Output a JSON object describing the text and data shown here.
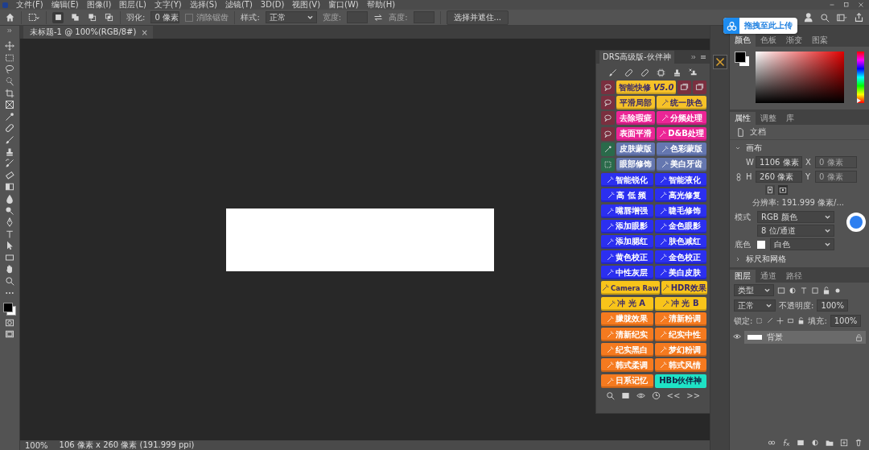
{
  "menu": [
    "文件(F)",
    "编辑(E)",
    "图像(I)",
    "图层(L)",
    "文字(Y)",
    "选择(S)",
    "滤镜(T)",
    "3D(D)",
    "视图(V)",
    "窗口(W)",
    "帮助(H)"
  ],
  "options": {
    "modes": [
      {
        "selected": true
      },
      {
        "selected": false
      },
      {
        "selected": false
      },
      {
        "selected": false
      }
    ],
    "feather_label": "羽化:",
    "feather_value": "0 像素",
    "antialias": {
      "label": "消除锯齿",
      "checked": false,
      "disabled": true
    },
    "style_label": "样式:",
    "style_value": "正常",
    "width_label": "宽度:",
    "height_label": "高度:",
    "mask_button": "选择并遮住..."
  },
  "document_tab": {
    "title": "未标题-1 @ 100%(RGB/8#)",
    "close": "×"
  },
  "upload_badge": "拖拽至此上传",
  "plugin": {
    "title": "DRS高级版-伙伴神",
    "prev": "<<",
    "next": ">>",
    "rows": [
      {
        "kind": "title",
        "cells": [
          {
            "kind": "tool",
            "color": "#7a2f3f"
          },
          {
            "kind": "button",
            "label": "智能快修 *V5.0*",
            "color": "#f6c228"
          },
          {
            "kind": "tool",
            "color": "#7a2f3f"
          },
          {
            "kind": "tool",
            "color": "#7a2f3f"
          }
        ]
      },
      {
        "kind": "lead",
        "cells": [
          {
            "kind": "tool",
            "color": "#7a2f3f"
          },
          {
            "kind": "button",
            "label": "平滑局部",
            "color": "#f6c228"
          },
          {
            "kind": "button",
            "label": "统一肤色",
            "color": "#f6c228"
          }
        ]
      },
      {
        "kind": "lead",
        "cells": [
          {
            "kind": "tool",
            "color": "#7a2f3f"
          },
          {
            "kind": "button",
            "label": "去除瑕疵",
            "color": "#ec2596"
          },
          {
            "kind": "button",
            "label": "分频处理",
            "color": "#ec2596"
          }
        ]
      },
      {
        "kind": "lead",
        "cells": [
          {
            "kind": "tool",
            "color": "#7a2f3f"
          },
          {
            "kind": "button",
            "label": "表面平滑",
            "color": "#ec2596"
          },
          {
            "kind": "button",
            "label": "D&B处理",
            "color": "#ec2596"
          }
        ]
      },
      {
        "kind": "lead",
        "cells": [
          {
            "kind": "tool",
            "color": "#2a6a4a"
          },
          {
            "kind": "button",
            "label": "皮肤蒙版",
            "color": "#6577b0"
          },
          {
            "kind": "button",
            "label": "色彩蒙版",
            "color": "#6577b0"
          }
        ]
      },
      {
        "kind": "lead",
        "cells": [
          {
            "kind": "tool",
            "color": "#2a6a4a"
          },
          {
            "kind": "button",
            "label": "眼部修饰",
            "color": "#6577b0"
          },
          {
            "kind": "button",
            "label": "美白牙齿",
            "color": "#6577b0"
          }
        ]
      },
      {
        "kind": "pair",
        "cells": [
          {
            "kind": "button",
            "label": "智能锐化",
            "color": "#2b2ff0"
          },
          {
            "kind": "button",
            "label": "智能液化",
            "color": "#2b2ff0"
          }
        ]
      },
      {
        "kind": "pair",
        "cells": [
          {
            "kind": "button",
            "label": "高 低 频",
            "color": "#2b2ff0"
          },
          {
            "kind": "button",
            "label": "高光修复",
            "color": "#2b2ff0"
          }
        ]
      },
      {
        "kind": "pair",
        "cells": [
          {
            "kind": "button",
            "label": "嘴唇增强",
            "color": "#2b2ff0"
          },
          {
            "kind": "button",
            "label": "睫毛修饰",
            "color": "#2b2ff0"
          }
        ]
      },
      {
        "kind": "pair",
        "cells": [
          {
            "kind": "button",
            "label": "添加眼影",
            "color": "#2b2ff0"
          },
          {
            "kind": "button",
            "label": "金色眼影",
            "color": "#2b2ff0"
          }
        ]
      },
      {
        "kind": "pair",
        "cells": [
          {
            "kind": "button",
            "label": "添加腮红",
            "color": "#2b2ff0"
          },
          {
            "kind": "button",
            "label": "肤色减红",
            "color": "#2b2ff0"
          }
        ]
      },
      {
        "kind": "pair",
        "cells": [
          {
            "kind": "button",
            "label": "黄色校正",
            "color": "#2b2ff0"
          },
          {
            "kind": "button",
            "label": "金色校正",
            "color": "#2b2ff0"
          }
        ]
      },
      {
        "kind": "pair",
        "cells": [
          {
            "kind": "button",
            "label": "中性灰层",
            "color": "#2b2ff0"
          },
          {
            "kind": "button",
            "label": "美白皮肤",
            "color": "#2b2ff0"
          }
        ]
      },
      {
        "kind": "pair",
        "cells": [
          {
            "kind": "button",
            "label": "Camera Raw",
            "color": "#f8c41a"
          },
          {
            "kind": "button",
            "label": "HDR效果",
            "color": "#f8c41a"
          }
        ]
      },
      {
        "kind": "pair",
        "cells": [
          {
            "kind": "button",
            "label": "冲 光 A",
            "color": "#f8c41a"
          },
          {
            "kind": "button",
            "label": "冲 光 B",
            "color": "#f8c41a"
          }
        ]
      },
      {
        "kind": "pair",
        "cells": [
          {
            "kind": "button",
            "label": "朦胧效果",
            "color": "#f57a1f"
          },
          {
            "kind": "button",
            "label": "清新粉调",
            "color": "#f57a1f"
          }
        ]
      },
      {
        "kind": "pair",
        "cells": [
          {
            "kind": "button",
            "label": "清新纪实",
            "color": "#f57a1f"
          },
          {
            "kind": "button",
            "label": "纪实中性",
            "color": "#f57a1f"
          }
        ]
      },
      {
        "kind": "pair",
        "cells": [
          {
            "kind": "button",
            "label": "纪实黑白",
            "color": "#f57a1f"
          },
          {
            "kind": "button",
            "label": "梦幻粉调",
            "color": "#f57a1f"
          }
        ]
      },
      {
        "kind": "pair",
        "cells": [
          {
            "kind": "button",
            "label": "韩式柔调",
            "color": "#f57a1f"
          },
          {
            "kind": "button",
            "label": "韩式风情",
            "color": "#f57a1f"
          }
        ]
      },
      {
        "kind": "pair",
        "cells": [
          {
            "kind": "button",
            "label": "日系记忆",
            "color": "#f57a1f"
          },
          {
            "kind": "logo",
            "label": "HBb伙伴神",
            "color": "#1ee3c6"
          }
        ]
      }
    ]
  },
  "color_panel": {
    "hue_slider": {
      "level": 1
    },
    "tabs": [
      {
        "label": "颜色",
        "selected": true
      },
      {
        "label": "色板",
        "selected": false
      },
      {
        "label": "渐变",
        "selected": false
      },
      {
        "label": "图案",
        "selected": false
      }
    ]
  },
  "properties": {
    "tabs": [
      {
        "label": "属性",
        "selected": true
      },
      {
        "label": "调整",
        "selected": false
      },
      {
        "label": "库",
        "selected": false
      }
    ],
    "doc_label": "文档",
    "canvas_section": {
      "title": "画布",
      "expanded": true
    },
    "w_label": "W",
    "w_value": "1106 像素",
    "x_label": "X",
    "x_placeholder": "0 像素",
    "h_label": "H",
    "h_value": "260 像素",
    "y_label": "Y",
    "y_placeholder": "0 像素",
    "resolution": "分辨率: 191.999 像素/...",
    "mode_label": "模式",
    "mode_value": "RGB 颜色",
    "depth_value": "8 位/通道",
    "canvas_color_label": "底色",
    "canvas_color_value": "白色",
    "ruler_section": {
      "title": "标尺和网格",
      "expanded": false
    }
  },
  "layers": {
    "tabs": [
      {
        "label": "图层",
        "selected": true
      },
      {
        "label": "通道",
        "selected": false
      },
      {
        "label": "路径",
        "selected": false
      }
    ],
    "filter_value": "类型",
    "blend_value": "正常",
    "opacity_label": "不透明度:",
    "opacity_value": "100%",
    "lock_label": "锁定:",
    "fill_label": "填充:",
    "fill_value": "100%",
    "items": [
      {
        "name": "背景",
        "visible": true,
        "selected": true,
        "locked": true
      }
    ]
  },
  "status": {
    "zoom": "100%",
    "info": "106 像素 x 260 像素 (191.999 ppi)"
  }
}
